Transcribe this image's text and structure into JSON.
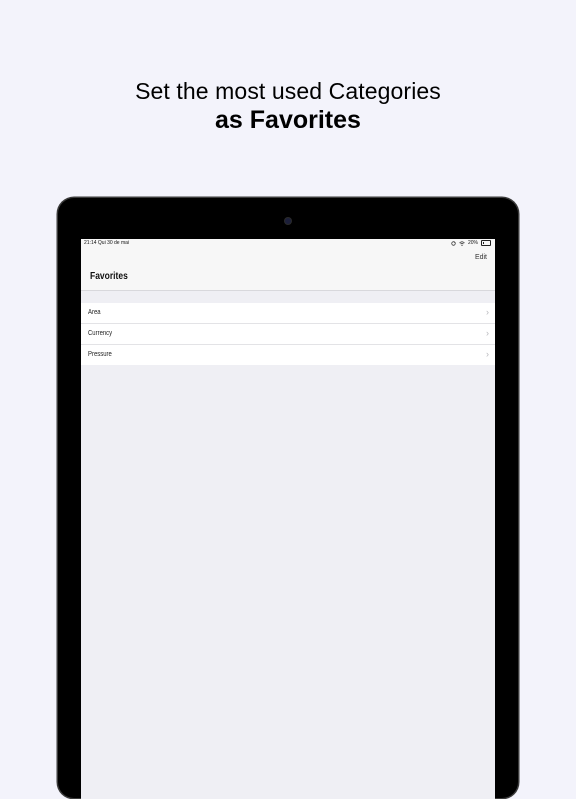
{
  "headline": {
    "line1": "Set the most used Categories",
    "line2": "as Favorites"
  },
  "status_bar": {
    "time_date": "21:14   Qui 30 de mai",
    "battery": "20%",
    "battery_level": 0.2,
    "icons": [
      "sync-icon",
      "wifi-icon",
      "battery-icon"
    ]
  },
  "navbar": {
    "edit_label": "Edit",
    "title": "Favorites"
  },
  "favorites": [
    {
      "label": "Area"
    },
    {
      "label": "Currency"
    },
    {
      "label": "Pressure"
    }
  ]
}
